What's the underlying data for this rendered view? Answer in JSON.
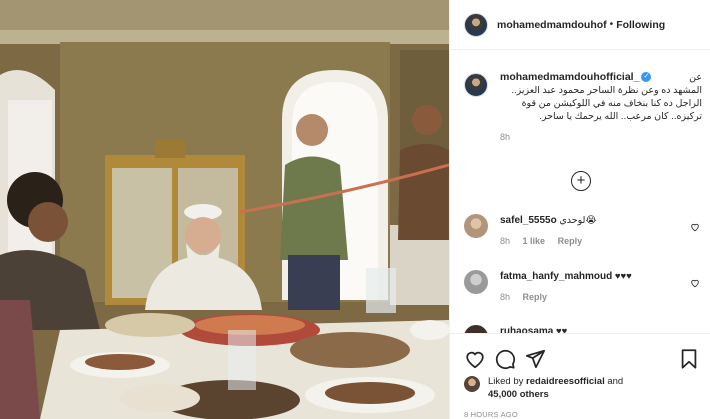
{
  "post": {
    "username": "mohamedmamdouhof",
    "separator": "•",
    "follow_label": "Following"
  },
  "caption": {
    "username": "mohamedmamdouhofficial_",
    "verified_glyph": "✓",
    "line1": "عن",
    "line2": "المشهد ده وعن نظرة الساحر محمود عبد العزيز..",
    "line3": "الراجل ده كنا بنخاف منه في اللوكيشن من قوة",
    "line4": "تركيزه.. كان مرعب.. الله يرحمك يا ساحر.",
    "time": "8h"
  },
  "load_more_glyph": "+",
  "comments": [
    {
      "username": "safel_5555o",
      "text": "لوحدي😭",
      "time": "8h",
      "likes": "1 like",
      "reply": "Reply"
    },
    {
      "username": "fatma_hanfy_mahmoud",
      "text": "♥♥♥",
      "time": "8h",
      "likes": "",
      "reply": "Reply"
    },
    {
      "username": "ruhaosama",
      "text": "♥♥",
      "time": "",
      "likes": "",
      "reply": ""
    }
  ],
  "actions": {
    "like_icon": "heart-icon",
    "comment_icon": "comment-icon",
    "share_icon": "share-icon",
    "save_icon": "bookmark-icon"
  },
  "likes": {
    "prefix": "Liked by",
    "user": "redaidreesofficial",
    "and": "and",
    "count": "45,000 others"
  },
  "posted_ago": "8 HOURS AGO",
  "colors": {
    "link_blue": "#3897f0",
    "muted": "#8e8e8e",
    "text": "#262626",
    "border": "#efefef"
  }
}
